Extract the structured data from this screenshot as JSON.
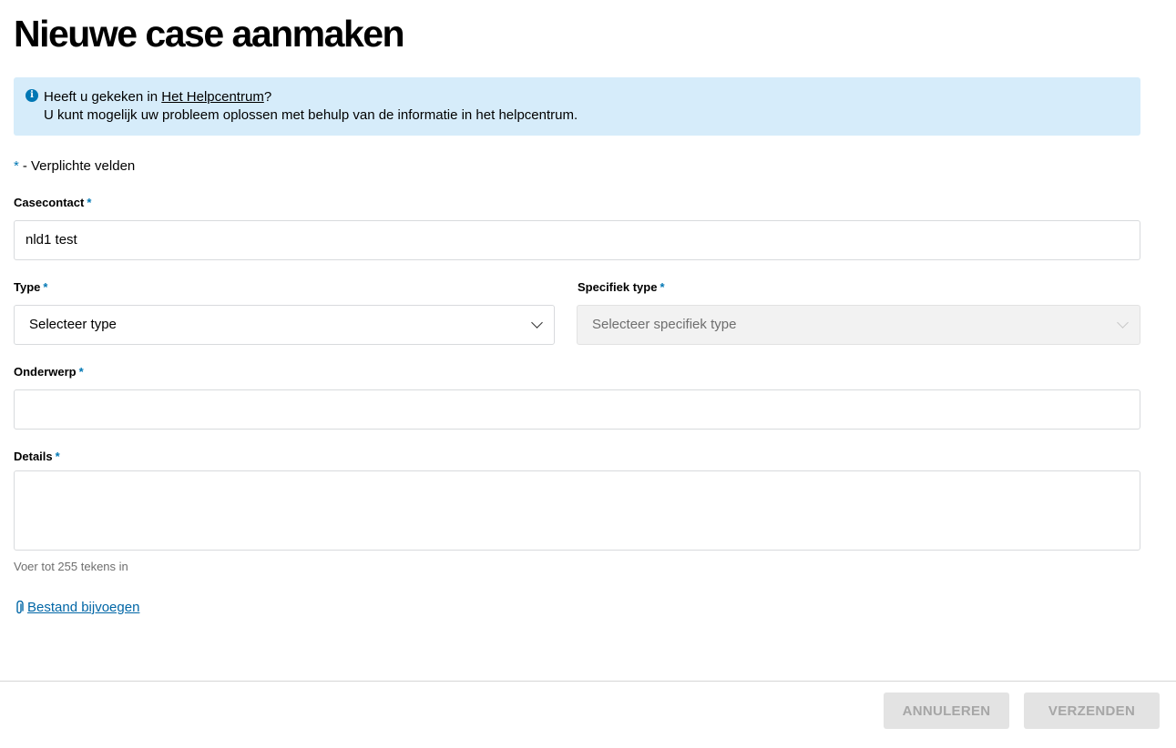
{
  "page": {
    "title": "Nieuwe case aanmaken"
  },
  "info": {
    "prefix": "Heeft u gekeken in ",
    "link": "Het Helpcentrum",
    "suffix": "?",
    "line2": "U kunt mogelijk uw probleem oplossen met behulp van de informatie in het helpcentrum."
  },
  "required_note": {
    "star": "*",
    "text": "- Verplichte velden"
  },
  "form": {
    "casecontact": {
      "label": "Casecontact",
      "value": "nld1 test"
    },
    "type": {
      "label": "Type",
      "selected": "Selecteer type"
    },
    "specific_type": {
      "label": "Specifiek type",
      "selected": "Selecteer specifiek type"
    },
    "subject": {
      "label": "Onderwerp",
      "value": ""
    },
    "details": {
      "label": "Details",
      "value": "",
      "hint": "Voer tot 255 tekens in"
    },
    "attach": {
      "label": "Bestand bijvoegen"
    }
  },
  "footer": {
    "cancel_label": "ANNULEREN",
    "submit_label": "VERZENDEN"
  },
  "colors": {
    "accent": "#0077b4",
    "banner_bg": "#d6ecfa",
    "link": "#0066a6"
  }
}
